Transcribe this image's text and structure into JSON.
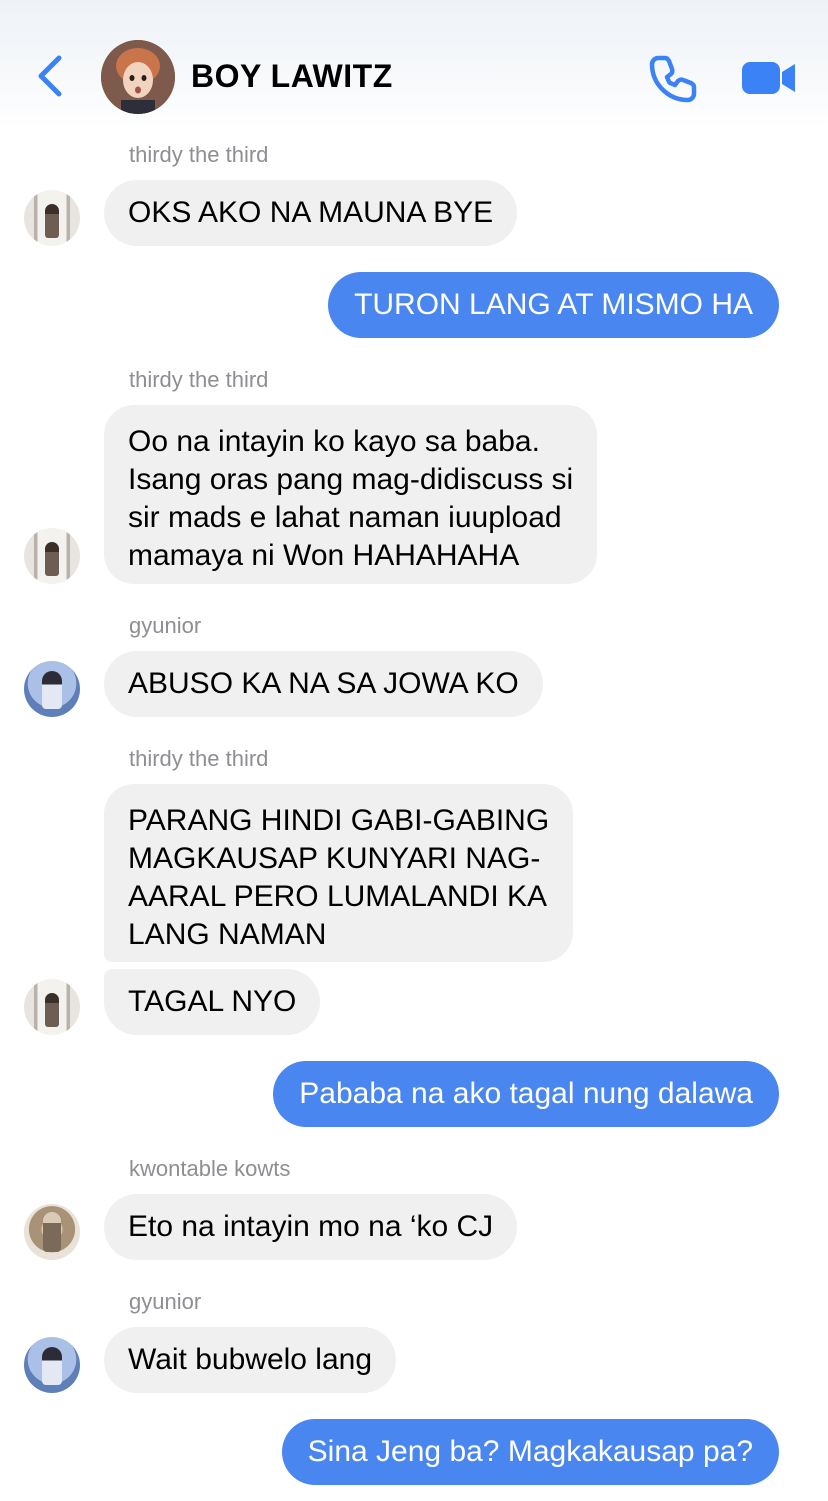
{
  "header": {
    "title": "BOY LAWITZ",
    "back_icon": "chevron-left-icon",
    "call_icon": "phone-icon",
    "video_icon": "video-camera-icon",
    "accent_color": "#3b82f6"
  },
  "messages": [
    {
      "id": "m1",
      "direction": "incoming",
      "sender": "thirdy the third",
      "lines": [
        "OKS AKO NA MAUNA BYE"
      ]
    },
    {
      "id": "m2",
      "direction": "outgoing",
      "lines": [
        "TURON LANG AT MISMO HA"
      ]
    },
    {
      "id": "m3",
      "direction": "incoming",
      "sender": "thirdy the third",
      "lines": [
        "Oo na intayin ko kayo sa baba.",
        "Isang oras pang mag-didiscuss si",
        "sir mads e lahat naman iuupload",
        "mamaya ni Won HAHAHAHA"
      ]
    },
    {
      "id": "m4",
      "direction": "incoming",
      "sender": "gyunior",
      "lines": [
        "ABUSO KA NA SA JOWA KO"
      ]
    },
    {
      "id": "m5",
      "direction": "incoming",
      "sender": "thirdy the third",
      "lines": [
        "PARANG HINDI GABI-GABING",
        "MAGKAUSAP KUNYARI NAG-",
        "AARAL PERO LUMALANDI KA",
        "LANG NAMAN"
      ]
    },
    {
      "id": "m6",
      "direction": "incoming",
      "lines": [
        "TAGAL NYO"
      ]
    },
    {
      "id": "m7",
      "direction": "outgoing",
      "lines": [
        "Pababa na ako tagal nung dalawa"
      ]
    },
    {
      "id": "m8",
      "direction": "incoming",
      "sender": "kwontable kowts",
      "lines": [
        "Eto na intayin mo na ‘ko CJ"
      ]
    },
    {
      "id": "m9",
      "direction": "incoming",
      "sender": "gyunior",
      "lines": [
        "Wait bubwelo lang"
      ]
    },
    {
      "id": "m10",
      "direction": "outgoing",
      "lines": [
        "Sina Jeng ba? Magkakausap pa?"
      ]
    }
  ],
  "colors": {
    "outgoing_bubble": "#4a86f0",
    "incoming_bubble": "#f0f0f0",
    "sender_label": "#8e8e93"
  }
}
